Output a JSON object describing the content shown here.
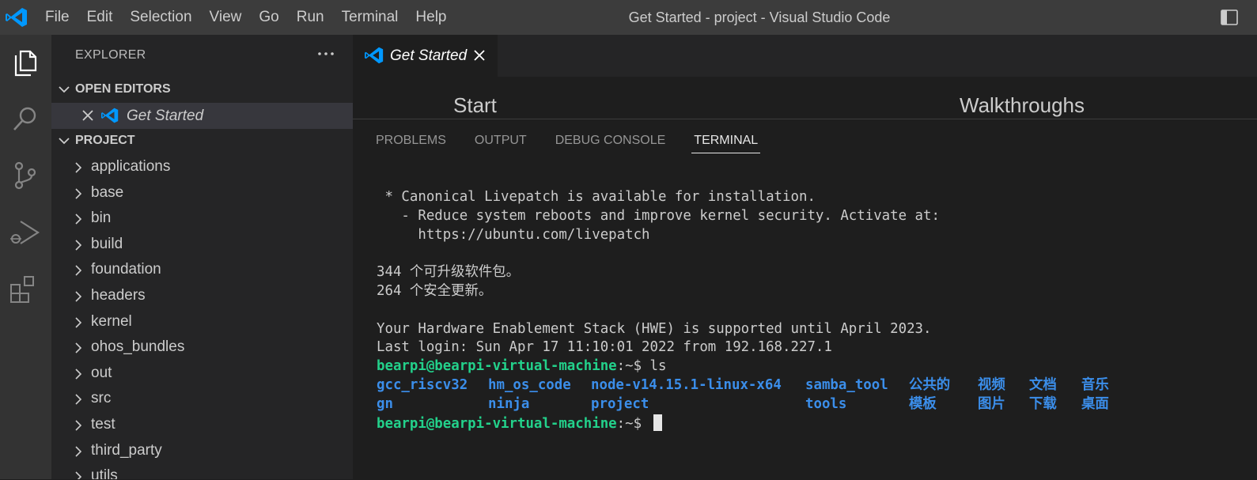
{
  "titlebar": {
    "menu": [
      "File",
      "Edit",
      "Selection",
      "View",
      "Go",
      "Run",
      "Terminal",
      "Help"
    ],
    "window_title": "Get Started - project - Visual Studio Code"
  },
  "activitybar": {
    "items": [
      "explorer-icon",
      "search-icon",
      "source-control-icon",
      "run-debug-icon",
      "extensions-icon"
    ]
  },
  "sidebar": {
    "title": "EXPLORER",
    "open_editors_label": "OPEN EDITORS",
    "open_editors": [
      {
        "name": "Get Started"
      }
    ],
    "project_label": "PROJECT",
    "tree": [
      "applications",
      "base",
      "bin",
      "build",
      "foundation",
      "headers",
      "kernel",
      "ohos_bundles",
      "out",
      "src",
      "test",
      "third_party",
      "utils"
    ]
  },
  "editor": {
    "tab_title": "Get Started",
    "get_started": {
      "start": "Start",
      "walkthroughs": "Walkthroughs"
    }
  },
  "panel": {
    "tabs": [
      "PROBLEMS",
      "OUTPUT",
      "DEBUG CONSOLE",
      "TERMINAL"
    ],
    "active_tab": "TERMINAL",
    "terminal": {
      "lines": [
        " * Canonical Livepatch is available for installation.",
        "   - Reduce system reboots and improve kernel security. Activate at:",
        "     https://ubuntu.com/livepatch",
        "",
        "344 个可升级软件包。",
        "264 个安全更新。",
        "",
        "Your Hardware Enablement Stack (HWE) is supported until April 2023.",
        "Last login: Sun Apr 17 11:10:01 2022 from 192.168.227.1"
      ],
      "prompt_user": "bearpi@bearpi-virtual-machine",
      "prompt_path": ":~",
      "prompt_symbol": "$ ",
      "command": "ls",
      "ls_row1": [
        "gcc_riscv32",
        "hm_os_code",
        "node-v14.15.1-linux-x64",
        "samba_tool",
        "公共的",
        "视频",
        "文档",
        "音乐"
      ],
      "ls_row2": [
        "gn",
        "ninja",
        "project",
        "tools",
        "模板",
        "图片",
        "下载",
        "桌面"
      ]
    }
  },
  "colors": {
    "titlebar": "#3c3c3c",
    "activitybar": "#333333",
    "sidebar": "#252526",
    "editor": "#1e1e1e",
    "vscode_blue": "#0098ff",
    "prompt_green": "#23d18b",
    "dir_blue": "#3b8eea"
  }
}
